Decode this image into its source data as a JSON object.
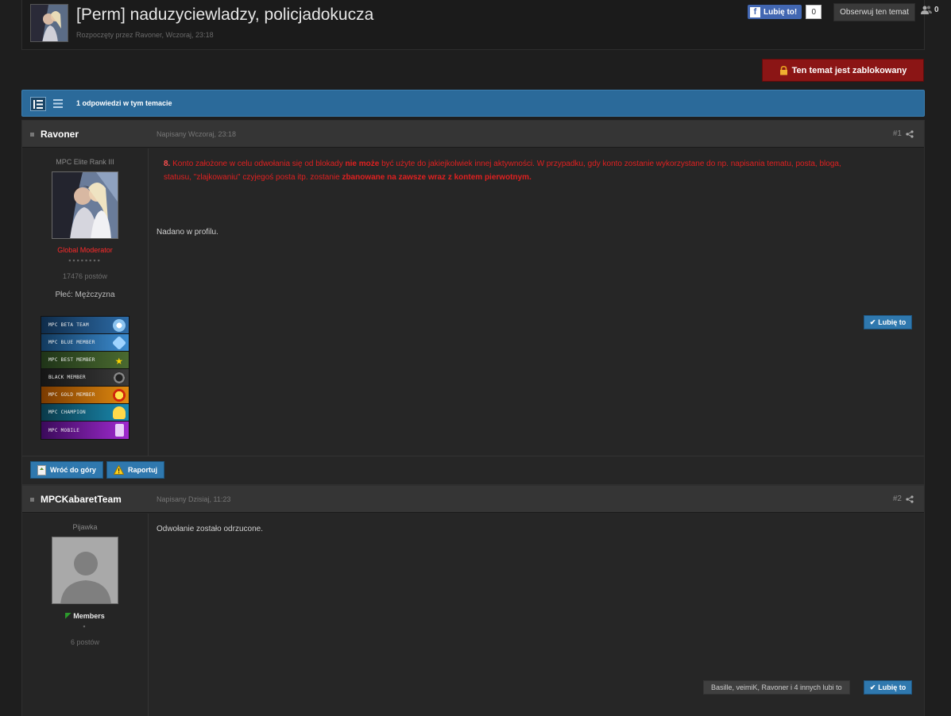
{
  "topic": {
    "title": "[Perm] naduzyciewladzy, policjadokucza",
    "started": "Rozpoczęty przez Ravoner, Wczoraj, 23:18"
  },
  "facebook": {
    "like_label": "Lubię to!",
    "icon": "f",
    "count": "0"
  },
  "follow": {
    "label": "Obserwuj ten temat",
    "followers": "0"
  },
  "locked": {
    "label": "Ten temat jest zablokowany"
  },
  "replies_bar": {
    "text": "1 odpowiedzi w tym temacie"
  },
  "posts": [
    {
      "author": "Ravoner",
      "date": "Napisany Wczoraj, 23:18",
      "number": "#1",
      "rank": "MPC Elite Rank III",
      "group": "Global Moderator",
      "group_color": "#ff2a2a",
      "pips": "▪▪▪▪▪▪▪▪",
      "post_count": "17476 postów",
      "gender": "Płeć: Mężczyzna",
      "badges": [
        "MPC Beta Team",
        "MPC Blue Member",
        "MPC Best Member",
        "Black Member",
        "MPC Gold Member",
        "MPC Champion",
        "MPC Mobile"
      ],
      "rule": {
        "number": "8.",
        "p1": "Konto założone w celu odwołania się od blokady ",
        "p1_bold": "nie może",
        "p2": " być użyte do jakiejkolwiek innej aktywności. W przypadku, gdy konto zostanie wykorzystane do np. napisania tematu, posta, bloga,",
        "p3": "statusu, \"zlajkowaniu\" czyjegoś posta itp. zostanie ",
        "p3_bold": "zbanowane na zawsze wraz z kontem pierwotnym."
      },
      "body": "Nadano w profilu.",
      "like_button": "Lubię to",
      "back_to_top": "Wróć do góry",
      "report": "Raportuj"
    },
    {
      "author": "MPCKabaretTeam",
      "date": "Napisany Dzisiaj, 11:23",
      "number": "#2",
      "rank": "Pijawka",
      "group": "Members",
      "group_color": "#e0e0e0",
      "pips": "▪",
      "post_count": "6 postów",
      "body": "Odwołanie zostało odrzucone.",
      "likes_info": "Basille, veimiK, Ravoner i 4 innych lubi to",
      "like_button": "Lubię to"
    }
  ]
}
